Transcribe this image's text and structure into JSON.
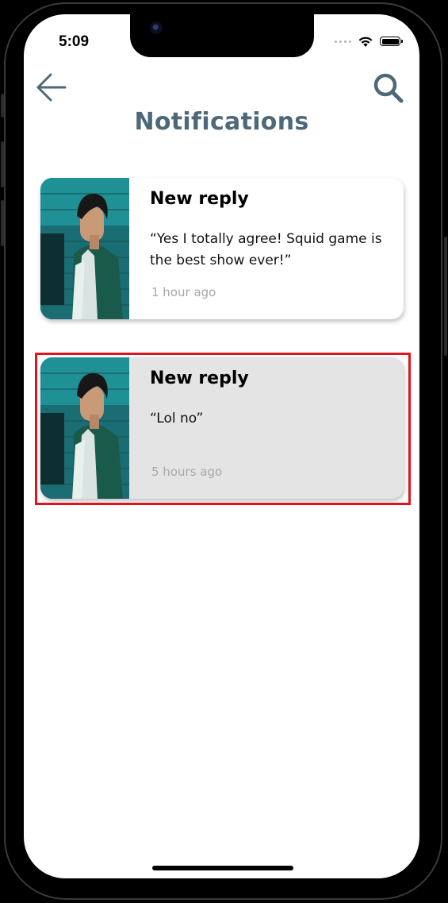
{
  "status_bar": {
    "time": "5:09"
  },
  "header": {
    "back_icon": "arrow-left-icon",
    "search_icon": "search-icon",
    "title": "Notifications",
    "title_color": "#4e6878"
  },
  "notifications": [
    {
      "title": "New reply",
      "message": "“Yes I totally agree! Squid game is the best show ever!”",
      "time": "1 hour ago",
      "selected": false
    },
    {
      "title": "New reply",
      "message": "“Lol no”",
      "time": "5 hours ago",
      "selected": true
    }
  ],
  "colors": {
    "highlight": "#e0141c",
    "selected_card_bg": "#e4e4e4",
    "time_text": "#a8a8a8"
  }
}
